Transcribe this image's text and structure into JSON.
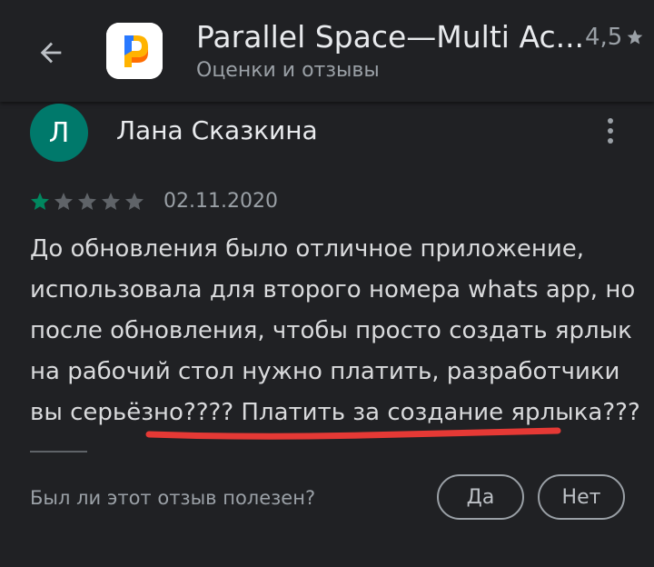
{
  "header": {
    "back_icon": "arrow-left-icon",
    "app_title": "Parallel Space—Multi Ac...",
    "subtitle": "Оценки и отзывы",
    "rating": "4,5",
    "rating_icon": "star-icon"
  },
  "review": {
    "avatar_letter": "Л",
    "avatar_color": "#00796b",
    "author": "Лана Сказкина",
    "menu_icon": "more-vert-icon",
    "stars_filled": 1,
    "stars_total": 5,
    "star_color": "#01875f",
    "date": "02.11.2020",
    "text": "До обновления было отличное приложение, использовала для второго номера whats app, но после обновления, чтобы просто создать ярлык на рабочий стол нужно платить, разработчики вы серьёзно???? Платить за создание ярлыка???"
  },
  "helpful": {
    "question": "Был ли этот отзыв полезен?",
    "yes_label": "Да",
    "no_label": "Нет"
  },
  "annotation": {
    "underline_color": "#e53935"
  }
}
